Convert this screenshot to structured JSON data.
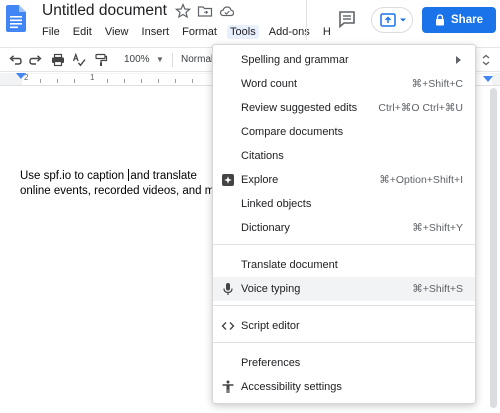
{
  "header": {
    "doc_title": "Untitled document",
    "menu": [
      "File",
      "Edit",
      "View",
      "Insert",
      "Format",
      "Tools",
      "Add-ons",
      "H"
    ],
    "active_menu": "Tools",
    "share_label": "Share"
  },
  "toolbar": {
    "zoom": "100%",
    "style": "Normal"
  },
  "ruler": {
    "marks": [
      "2",
      "1"
    ]
  },
  "document": {
    "line1_before": "Use spf.io to caption ",
    "line1_after": "and translate",
    "line2": "online events, recorded videos, and mo"
  },
  "tools_menu": {
    "items": [
      {
        "label": "Spelling and grammar",
        "shortcut": "",
        "icon": "",
        "submenu": true
      },
      {
        "label": "Word count",
        "shortcut": "⌘+Shift+C",
        "icon": ""
      },
      {
        "label": "Review suggested edits",
        "shortcut": "Ctrl+⌘O Ctrl+⌘U",
        "icon": ""
      },
      {
        "label": "Compare documents",
        "shortcut": "",
        "icon": ""
      },
      {
        "label": "Citations",
        "shortcut": "",
        "icon": ""
      },
      {
        "label": "Explore",
        "shortcut": "⌘+Option+Shift+I",
        "icon": "explore-icon"
      },
      {
        "label": "Linked objects",
        "shortcut": "",
        "icon": ""
      },
      {
        "label": "Dictionary",
        "shortcut": "⌘+Shift+Y",
        "icon": ""
      },
      {
        "label": "Translate document",
        "shortcut": "",
        "icon": ""
      },
      {
        "label": "Voice typing",
        "shortcut": "⌘+Shift+S",
        "icon": "microphone-icon",
        "highlighted": true
      },
      {
        "label": "Script editor",
        "shortcut": "",
        "icon": "code-icon"
      },
      {
        "label": "Preferences",
        "shortcut": "",
        "icon": ""
      },
      {
        "label": "Accessibility settings",
        "shortcut": "",
        "icon": "accessibility-icon"
      }
    ]
  },
  "colors": {
    "accent": "#1a73e8",
    "menu_highlight": "#f1f3f4",
    "active_menu_bg": "#e8f0fe",
    "docs_blue": "#4285f4"
  }
}
